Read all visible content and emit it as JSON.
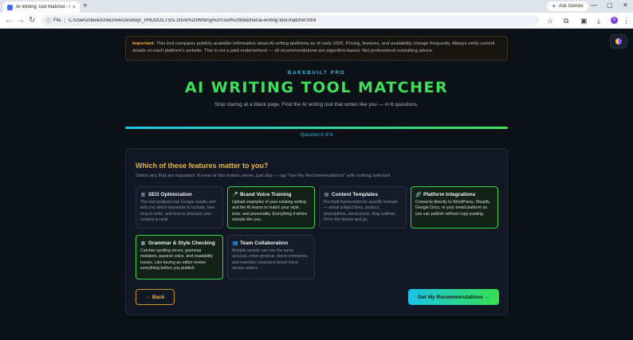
{
  "browser": {
    "tab_title": "AI Writing Tool Matcher - Bake",
    "tab_close": "×",
    "new_tab": "+",
    "gemini_label": "Ask Gemini",
    "gemini_icon": "✦",
    "window_controls": [
      "—",
      "▢",
      "✕"
    ],
    "nav_back": "←",
    "nav_forward": "→",
    "nav_reload": "↻",
    "url_scheme": "File",
    "url": "C:/Users/steve/OneDrive/Desktop/_PRODUCTS/1-20/AI%20Writing%20Tool%20Matcher/ai-writing-tool-matcher.html",
    "profile_initial": "S",
    "icons": [
      "bookmark-star-icon",
      "extensions-icon",
      "sidebar-icon",
      "download-icon",
      "profile-icon",
      "menu-icon"
    ]
  },
  "notice": {
    "label": "Important:",
    "text": " This tool compares publicly available information about AI writing platforms as of early 2026. Pricing, features, and availability change frequently. Always verify current details on each platform's website. This is not a paid endorsement — all recommendations are algorithm-based. Not professional consulting advice."
  },
  "header": {
    "brand": "BAKEBUILT PRO",
    "title": "AI WRITING TOOL MATCHER",
    "subtitle": "Stop staring at a blank page. Find the AI writing tool that writes like you — in 6 questions."
  },
  "progress": {
    "current": 6,
    "total": 6,
    "fraction": 1.0,
    "label": "Question 6 of 6"
  },
  "question": {
    "title": "Which of these features matter to you?",
    "hint": "Select any that are important. If none of this makes sense, just skip — tap \"Get My Recommendations\" with nothing selected."
  },
  "options": [
    {
      "icon": "chart-icon",
      "glyph": "▥",
      "name": "SEO Optimization",
      "selected": false,
      "desc": "The tool analyzes top Google results and tells you which keywords to include, how long to write, and how to structure your content to rank."
    },
    {
      "icon": "microphone-icon",
      "glyph": "🎤",
      "name": "Brand Voice Training",
      "selected": true,
      "desc": "Upload examples of your existing writing and the AI learns to match your style, tone, and personality. Everything it writes sounds like you."
    },
    {
      "icon": "clipboard-icon",
      "glyph": "▤",
      "name": "Content Templates",
      "selected": false,
      "desc": "Pre-built frameworks for specific formats — email subject lines, product descriptions, social posts, blog outlines. Fill in the blanks and go."
    },
    {
      "icon": "link-icon",
      "glyph": "🔗",
      "name": "Platform Integrations",
      "selected": true,
      "desc": "Connects directly to WordPress, Shopify, Google Docs, or your email platform so you can publish without copy-pasting."
    },
    {
      "icon": "notebook-icon",
      "glyph": "▦",
      "name": "Grammar & Style Checking",
      "selected": true,
      "desc": "Catches spelling errors, grammar mistakes, passive voice, and readability issues. Like having an editor review everything before you publish."
    },
    {
      "icon": "team-icon",
      "glyph": "👥",
      "name": "Team Collaboration",
      "selected": false,
      "desc": "Multiple people can use the same account, share projects, leave comments, and maintain consistent brand voice across writers."
    }
  ],
  "buttons": {
    "back": "← Back",
    "recommend": "Get My Recommendations →"
  },
  "colors": {
    "accent_green": "#3ee05a",
    "accent_cyan": "#2fb8d6",
    "accent_gold": "#e8b442",
    "background": "#0c1017"
  }
}
